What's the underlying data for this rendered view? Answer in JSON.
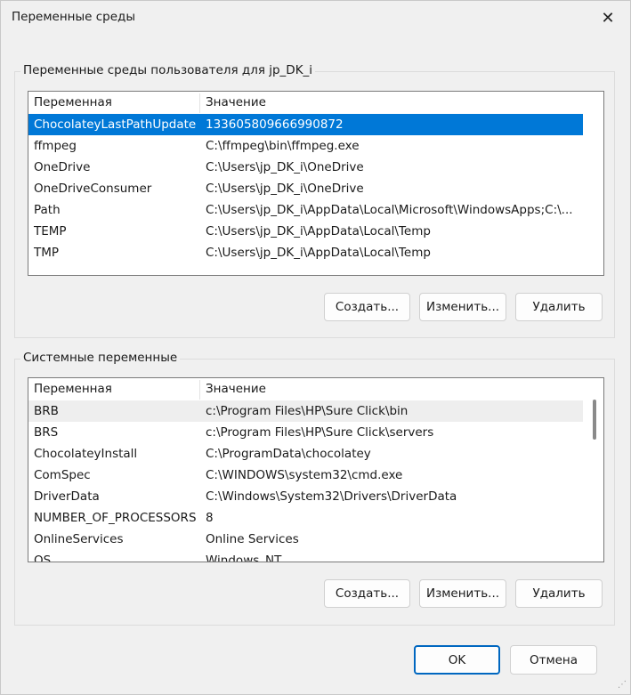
{
  "window": {
    "title": "Переменные среды",
    "close_glyph": "✕"
  },
  "user_vars": {
    "group_label": "Переменные среды пользователя для jp_DK_i",
    "headers": {
      "name": "Переменная",
      "value": "Значение"
    },
    "rows": [
      {
        "name": "ChocolateyLastPathUpdate",
        "value": "133605809666990872"
      },
      {
        "name": "ffmpeg",
        "value": "C:\\ffmpeg\\bin\\ffmpeg.exe"
      },
      {
        "name": "OneDrive",
        "value": "C:\\Users\\jp_DK_i\\OneDrive"
      },
      {
        "name": "OneDriveConsumer",
        "value": "C:\\Users\\jp_DK_i\\OneDrive"
      },
      {
        "name": "Path",
        "value": "C:\\Users\\jp_DK_i\\AppData\\Local\\Microsoft\\WindowsApps;C:\\..."
      },
      {
        "name": "TEMP",
        "value": "C:\\Users\\jp_DK_i\\AppData\\Local\\Temp"
      },
      {
        "name": "TMP",
        "value": "C:\\Users\\jp_DK_i\\AppData\\Local\\Temp"
      }
    ],
    "buttons": {
      "create": "Создать...",
      "edit": "Изменить...",
      "delete": "Удалить"
    }
  },
  "system_vars": {
    "group_label": "Системные переменные",
    "headers": {
      "name": "Переменная",
      "value": "Значение"
    },
    "rows": [
      {
        "name": "BRB",
        "value": "c:\\Program Files\\HP\\Sure Click\\bin"
      },
      {
        "name": "BRS",
        "value": "c:\\Program Files\\HP\\Sure Click\\servers"
      },
      {
        "name": "ChocolateyInstall",
        "value": "C:\\ProgramData\\chocolatey"
      },
      {
        "name": "ComSpec",
        "value": "C:\\WINDOWS\\system32\\cmd.exe"
      },
      {
        "name": "DriverData",
        "value": "C:\\Windows\\System32\\Drivers\\DriverData"
      },
      {
        "name": "NUMBER_OF_PROCESSORS",
        "value": "8"
      },
      {
        "name": "OnlineServices",
        "value": "Online Services"
      },
      {
        "name": "OS",
        "value": "Windows_NT"
      }
    ],
    "buttons": {
      "create": "Создать...",
      "edit": "Изменить...",
      "delete": "Удалить"
    }
  },
  "footer": {
    "ok": "OK",
    "cancel": "Отмена"
  },
  "colors": {
    "selection": "#0078d7",
    "ok_border": "#0067c0"
  }
}
